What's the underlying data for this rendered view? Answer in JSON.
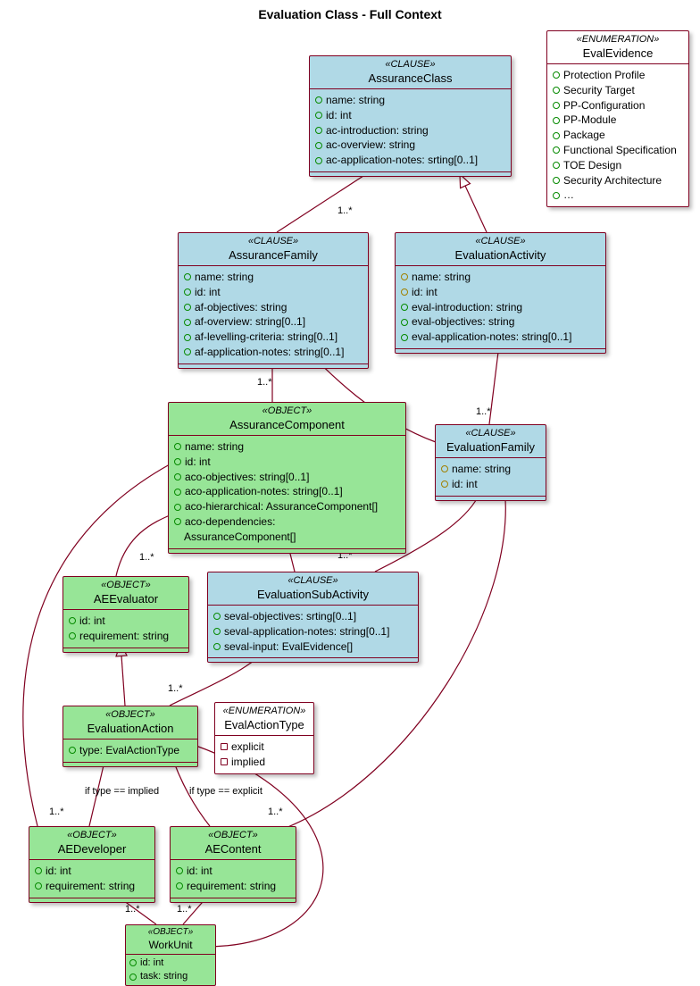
{
  "title": "Evaluation Class - Full Context",
  "stereotypes": {
    "clause": "«CLAUSE»",
    "object": "«OBJECT»",
    "enum": "«ENUMERATION»"
  },
  "classes": {
    "AssuranceClass": {
      "name": "AssuranceClass",
      "attrs": [
        "name: string",
        "id: int",
        "ac-introduction: string",
        "ac-overview: string",
        "ac-application-notes: srting[0..1]"
      ]
    },
    "EvalEvidence": {
      "name": "EvalEvidence",
      "attrs": [
        "Protection Profile",
        "Security Target",
        "PP-Configuration",
        "PP-Module",
        "Package",
        "Functional Specification",
        "TOE Design",
        "Security Architecture",
        "…"
      ]
    },
    "AssuranceFamily": {
      "name": "AssuranceFamily",
      "attrs": [
        "name: string",
        "id: int",
        "af-objectives: string",
        "af-overview: string[0..1]",
        "af-levelling-criteria: string[0..1]",
        "af-application-notes: string[0..1]"
      ]
    },
    "EvaluationActivity": {
      "name": "EvaluationActivity",
      "attrs": [
        "name: string",
        "id: int",
        "eval-introduction: string",
        "eval-objectives: string",
        "eval-application-notes: string[0..1]"
      ]
    },
    "AssuranceComponent": {
      "name": "AssuranceComponent",
      "attrs": [
        "name: string",
        "id: int",
        "aco-objectives: string[0..1]",
        "aco-application-notes: string[0..1]",
        "aco-hierarchical: AssuranceComponent[]",
        "aco-dependencies:",
        "AssuranceComponent[]"
      ]
    },
    "EvaluationFamily": {
      "name": "EvaluationFamily",
      "attrs": [
        "name: string",
        "id: int"
      ]
    },
    "AEEvaluator": {
      "name": "AEEvaluator",
      "attrs": [
        "id: int",
        "requirement: string"
      ]
    },
    "EvaluationSubActivity": {
      "name": "EvaluationSubActivity",
      "attrs": [
        "seval-objectives: srting[0..1]",
        "seval-application-notes: string[0..1]",
        "seval-input: EvalEvidence[]"
      ]
    },
    "EvaluationAction": {
      "name": "EvaluationAction",
      "attrs": [
        "type: EvalActionType"
      ]
    },
    "EvalActionType": {
      "name": "EvalActionType",
      "attrs": [
        "explicit",
        "implied"
      ]
    },
    "AEDeveloper": {
      "name": "AEDeveloper",
      "attrs": [
        "id: int",
        "requirement: string"
      ]
    },
    "AEContent": {
      "name": "AEContent",
      "attrs": [
        "id: int",
        "requirement: string"
      ]
    },
    "WorkUnit": {
      "name": "WorkUnit",
      "attrs": [
        "id: int",
        "task: string"
      ]
    }
  },
  "labels": {
    "one_star": "1..*",
    "cond_implied": "if type == implied",
    "cond_explicit": "if type == explicit"
  },
  "colors": {
    "border": "#800020",
    "blue": "#b0d9e6",
    "green": "#97e597"
  },
  "chart_data": {
    "type": "uml-class-diagram",
    "title": "Evaluation Class - Full Context",
    "relationships": [
      {
        "from": "AssuranceFamily",
        "to": "AssuranceClass",
        "type": "composition",
        "multiplicity": "1..*"
      },
      {
        "from": "EvaluationActivity",
        "to": "AssuranceClass",
        "type": "generalization"
      },
      {
        "from": "AssuranceComponent",
        "to": "AssuranceFamily",
        "type": "composition",
        "multiplicity": "1..*"
      },
      {
        "from": "EvaluationFamily",
        "to": "EvaluationActivity",
        "type": "composition",
        "multiplicity": "1..*"
      },
      {
        "from": "EvaluationFamily",
        "to": "AssuranceFamily",
        "type": "generalization"
      },
      {
        "from": "EvaluationSubActivity",
        "to": "EvaluationFamily",
        "type": "composition",
        "multiplicity": "1..*"
      },
      {
        "from": "EvaluationSubActivity",
        "to": "AssuranceComponent",
        "type": "generalization"
      },
      {
        "from": "AEEvaluator",
        "to": "AssuranceComponent",
        "type": "composition",
        "multiplicity": "1..*"
      },
      {
        "from": "AEDeveloper",
        "to": "AssuranceComponent",
        "type": "composition",
        "multiplicity": "1..*"
      },
      {
        "from": "AEContent",
        "to": "AssuranceComponent",
        "type": "composition",
        "multiplicity": "1..*"
      },
      {
        "from": "EvaluationAction",
        "to": "EvaluationSubActivity",
        "type": "composition",
        "multiplicity": "1..*"
      },
      {
        "from": "EvaluationAction",
        "to": "AEEvaluator",
        "type": "generalization"
      },
      {
        "from": "AEDeveloper",
        "to": "EvaluationAction",
        "type": "aggregation",
        "condition": "if type == implied"
      },
      {
        "from": "AEContent",
        "to": "EvaluationAction",
        "type": "aggregation",
        "condition": "if type == explicit"
      },
      {
        "from": "WorkUnit",
        "to": "AEDeveloper",
        "type": "composition",
        "multiplicity": "1..*"
      },
      {
        "from": "WorkUnit",
        "to": "AEContent",
        "type": "composition",
        "multiplicity": "1..*"
      },
      {
        "from": "WorkUnit",
        "to": "EvaluationAction",
        "type": "composition",
        "multiplicity": "1..*"
      }
    ]
  }
}
